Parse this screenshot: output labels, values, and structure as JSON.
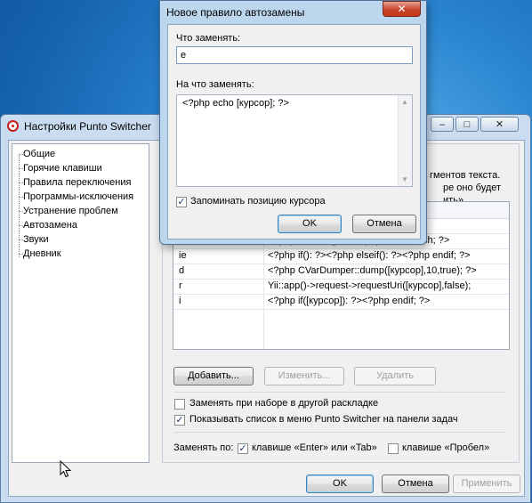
{
  "main_window": {
    "title": "Настройки Punto Switcher",
    "caption_buttons": {
      "minimize": "–",
      "maximize": "□",
      "close": "✕"
    }
  },
  "tree": {
    "items": [
      "Общие",
      "Горячие клавиши",
      "Правила переключения",
      "Программы-исключения",
      "Устранение проблем",
      "Автозамена",
      "Звуки",
      "Дневник"
    ],
    "selected": "Автозамена"
  },
  "panel": {
    "desc_lines": [
      "гментов текста.",
      "ре оно будет",
      "ить»."
    ],
    "table": {
      "rows": [
        {
          "key": "f",
          "value": "<?php foreach(): ?><?php endforeach; ?>"
        },
        {
          "key": "ie",
          "value": "<?php if(): ?><?php elseif(): ?><?php endif; ?>"
        },
        {
          "key": "d",
          "value": "<?php CVarDumper::dump([курсор],10,true); ?>"
        },
        {
          "key": "r",
          "value": "Yii::app()->request->requestUri([курсор],false);"
        },
        {
          "key": "i",
          "value": "<?php if([курсор]): ?><?php endif; ?>"
        }
      ]
    },
    "buttons": {
      "add": "Добавить...",
      "edit": "Изменить...",
      "delete": "Удалить"
    },
    "checkboxes": {
      "replace_other_layout": {
        "label": "Заменять при наборе в другой раскладке",
        "checked": false
      },
      "show_list_menu": {
        "label": "Показывать список в меню Punto Switcher на панели задач",
        "checked": true
      }
    },
    "replace_on": {
      "label": "Заменять по:",
      "enter_tab": {
        "label": "клавише «Enter» или «Tab»",
        "checked": true
      },
      "space": {
        "label": "клавише «Пробел»",
        "checked": false
      }
    }
  },
  "footer": {
    "ok": "OK",
    "cancel": "Отмена",
    "apply": "Применить"
  },
  "dialog": {
    "title": "Новое правило автозамены",
    "close": "✕",
    "find_label": "Что заменять:",
    "find_value": "e",
    "replace_label": "На что заменять:",
    "replace_value": "<?php echo [курсор]; ?>",
    "remember_cursor": {
      "label": "Запоминать позицию курсора",
      "checked": true
    },
    "ok": "OK",
    "cancel": "Отмена"
  }
}
